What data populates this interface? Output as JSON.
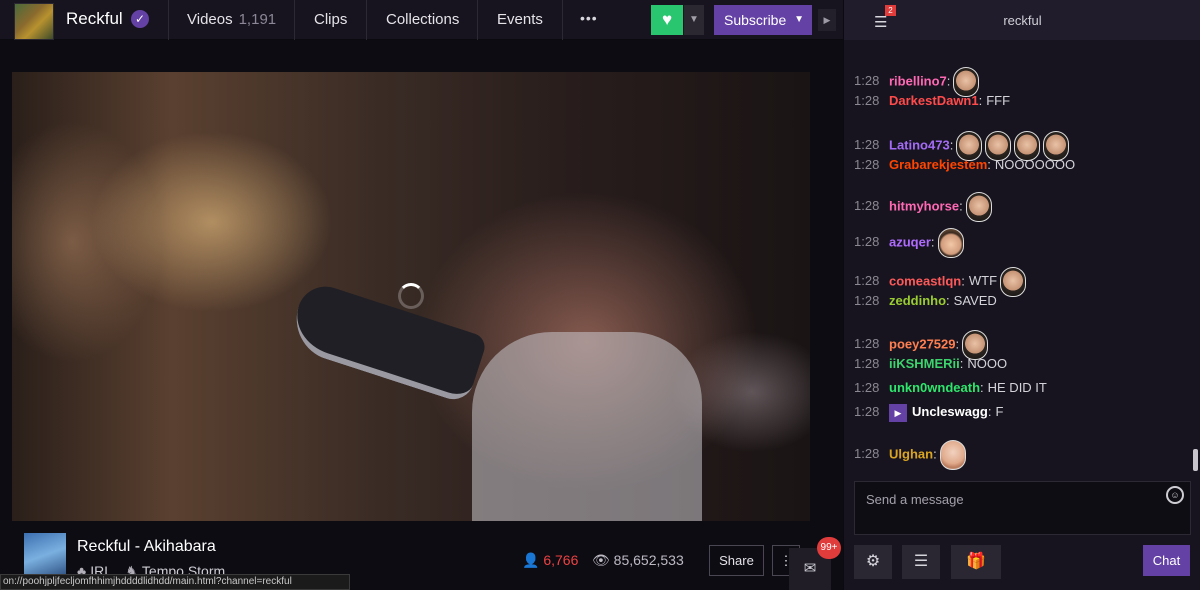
{
  "nav": {
    "channel_name": "Reckful",
    "verified_glyph": "✓",
    "videos_label": "Videos",
    "videos_count": "1,191",
    "clips_label": "Clips",
    "collections_label": "Collections",
    "events_label": "Events",
    "more_glyph": "•••",
    "follow_glyph": "♥",
    "dropdown_glyph": "▼",
    "subscribe_label": "Subscribe",
    "collapse_glyph": "▶"
  },
  "stream": {
    "title": "Reckful - Akihabara",
    "game": "IRL",
    "team": "Tempo Storm",
    "viewers": "6,766",
    "views": "85,652,533",
    "share_label": "Share",
    "more_glyph": "⋮",
    "whisper_badge": "99+",
    "status_url": "on://poohjpljfecljomfhhimjhddddlidhdd/main.html?channel=reckful"
  },
  "chat": {
    "title": "reckful",
    "list_badge": "2",
    "placeholder": "Send a message",
    "send_label": "Chat",
    "messages": [
      {
        "time": "1:28",
        "nick": "ribellino7",
        "color": "#ff69b4",
        "text": "",
        "emotes": 1
      },
      {
        "time": "1:28",
        "nick": "DarkestDawn1",
        "color": "#ff4b4b",
        "text": "FFF",
        "emotes": 0
      },
      {
        "time": "1:28",
        "nick": "Latino473",
        "color": "#a46cf5",
        "text": "",
        "emotes": 4
      },
      {
        "time": "1:28",
        "nick": "Grabarekjestem",
        "color": "#ff4500",
        "text": "NOOOOOOO",
        "emotes": 0
      },
      {
        "time": "1:28",
        "nick": "hitmyhorse",
        "color": "#ff69b4",
        "text": "",
        "emotes": 1
      },
      {
        "time": "1:28",
        "nick": "azuqer",
        "color": "#b06cff",
        "text": "",
        "emotes": 1
      },
      {
        "time": "1:28",
        "nick": "comeastlqn",
        "color": "#ff5a5a",
        "text": "WTF",
        "emotes": 1
      },
      {
        "time": "1:28",
        "nick": "zeddinho",
        "color": "#9acd32",
        "text": "SAVED",
        "emotes": 0
      },
      {
        "time": "1:28",
        "nick": "poey27529",
        "color": "#ff7f50",
        "text": "",
        "emotes": 1
      },
      {
        "time": "1:28",
        "nick": "iiKSHMERii",
        "color": "#3cd46c",
        "text": "NOOO",
        "emotes": 0
      },
      {
        "time": "1:28",
        "nick": "unkn0wndeath",
        "color": "#2ee66b",
        "text": "HE DID IT",
        "emotes": 0
      },
      {
        "time": "1:28",
        "nick": "Uncleswagg",
        "color": "#ffffff",
        "text": "F",
        "emotes": 0
      },
      {
        "time": "1:28",
        "nick": "Ulghan",
        "color": "#daa520",
        "text": "",
        "emotes": 1
      }
    ]
  },
  "icons": {
    "settings": "⚙",
    "list": "☰",
    "gift": "🎁",
    "emoji": "☺",
    "viewers": "👤",
    "views": "👁",
    "whisper": "✉"
  }
}
